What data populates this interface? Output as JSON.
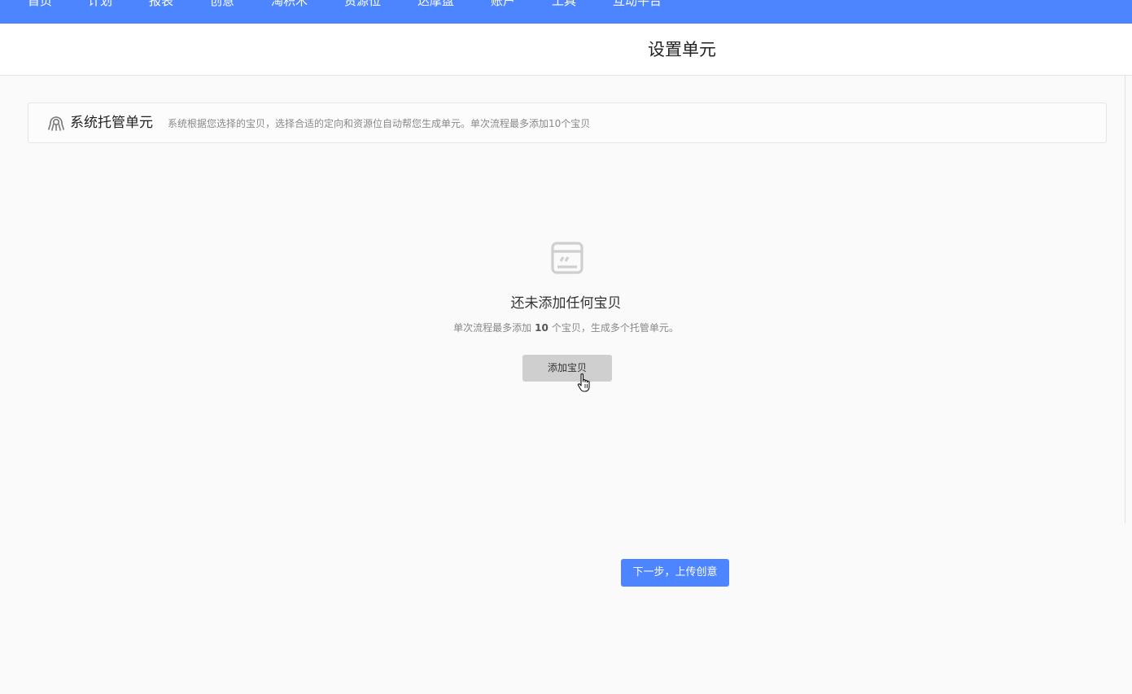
{
  "nav": {
    "items": [
      "首页",
      "计划",
      "报表",
      "创意",
      "淘积木",
      "资源位",
      "达摩盘",
      "账户",
      "工具",
      "互动平台"
    ]
  },
  "header": {
    "title": "设置单元"
  },
  "info_bar": {
    "icon": "hosting-octopus-icon",
    "title": "系统托管单元",
    "description": "系统根据您选择的宝贝，选择合适的定向和资源位自动帮您生成单元。单次流程最多添加10个宝贝"
  },
  "empty_state": {
    "icon": "empty-box-icon",
    "title": "还未添加任何宝贝",
    "desc_prefix": "单次流程最多添加",
    "desc_count": "10",
    "desc_suffix": "个宝贝，生成多个托管单元。",
    "add_button": "添加宝贝"
  },
  "footer": {
    "next_button": "下一步，上传创意"
  },
  "colors": {
    "brand": "#4d84ff",
    "button_gray": "#cfcfcf"
  }
}
